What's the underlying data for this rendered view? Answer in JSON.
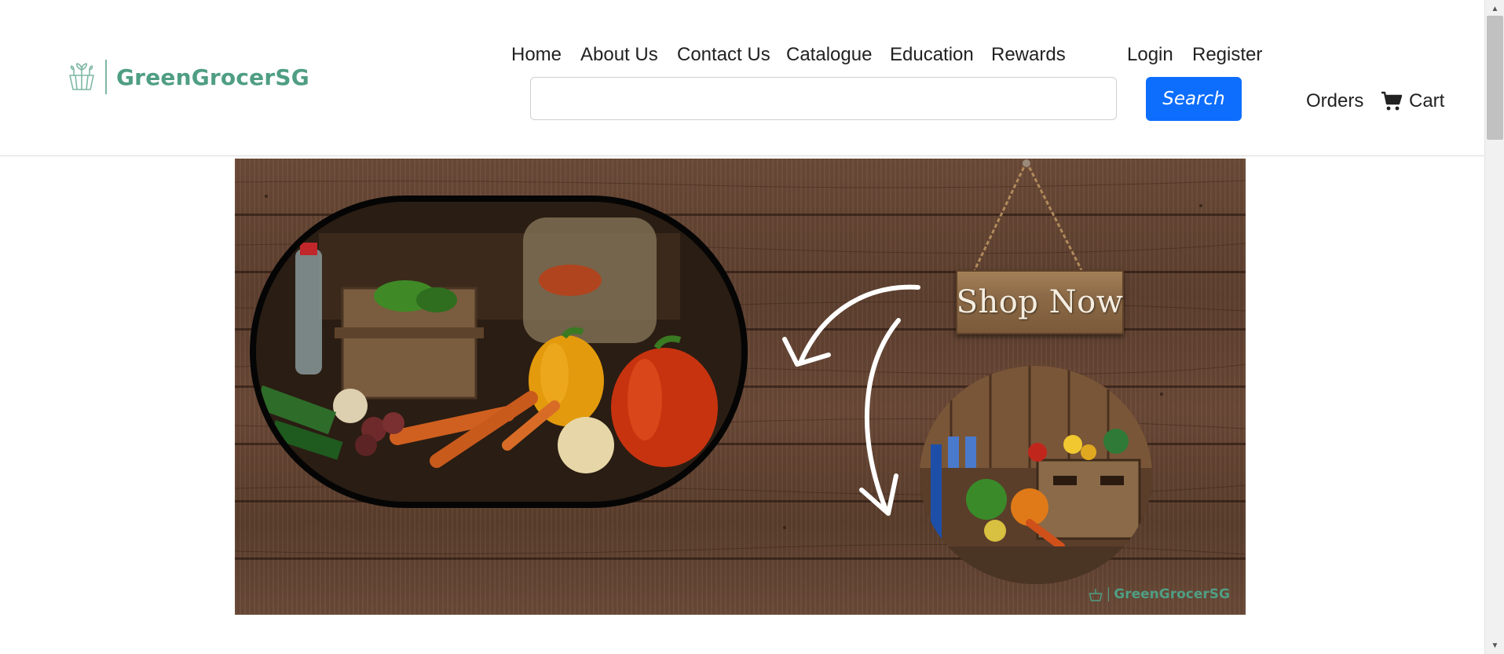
{
  "brand": {
    "name": "GreenGrocerSG",
    "accent_color": "#4f9e83",
    "logo_icon": "plant-basket-icon"
  },
  "nav": {
    "items": [
      {
        "label": "Home"
      },
      {
        "label": "About Us"
      },
      {
        "label": "Contact Us"
      },
      {
        "label": "Catalogue"
      },
      {
        "label": "Education"
      },
      {
        "label": "Rewards"
      }
    ],
    "account": [
      {
        "label": "Login"
      },
      {
        "label": "Register"
      }
    ]
  },
  "search": {
    "value": "",
    "placeholder": "",
    "button_label": "Search",
    "button_color": "#0d6efd"
  },
  "user_links": {
    "orders_label": "Orders",
    "cart_label": "Cart",
    "cart_icon": "shopping-cart-icon"
  },
  "banner": {
    "sign_text": "Shop Now",
    "watermark_text": "GreenGrocerSG"
  }
}
